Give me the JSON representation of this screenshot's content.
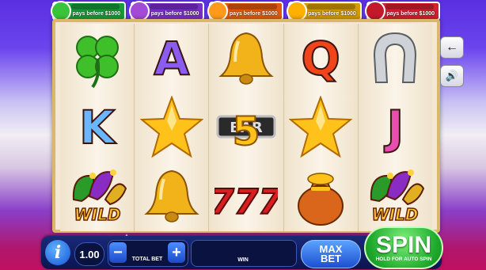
{
  "jackpots": [
    {
      "label": "pays before $1000",
      "color": "#1a9a3a",
      "face": "#3ac43a"
    },
    {
      "label": "pays before $1000",
      "color": "#7a2fc8",
      "face": "#a34ad6"
    },
    {
      "label": "pays before $1000",
      "color": "#e05a10",
      "face": "#ff9a1a"
    },
    {
      "label": "pays before $1000",
      "color": "#d49a00",
      "face": "#ffb000"
    },
    {
      "label": "pays before $1000",
      "color": "#d42030",
      "face": "#c21a2a"
    }
  ],
  "reels": [
    [
      "clover-icon",
      "K",
      "wild-jester-icon"
    ],
    [
      "A",
      "star-icon",
      "bell-icon"
    ],
    [
      "bell-icon",
      "bar-5-icon",
      "seven-icon"
    ],
    [
      "Q",
      "star-icon",
      "money-bag-icon"
    ],
    [
      "horseshoe-icon",
      "J",
      "wild-jester-icon"
    ]
  ],
  "symbols": {
    "wild": "WILD",
    "bar_text": "BAR",
    "bar_digit": "5",
    "seven": "777"
  },
  "side": {
    "back_icon": "←",
    "sound_icon": "🔊"
  },
  "bottom": {
    "info_icon": "i",
    "bet_value": "1.00",
    "minus": "−",
    "plus": "+",
    "total_bet_label": "TOTAL BET",
    "win_label": "WIN",
    "max_bet_line1": "MAX",
    "max_bet_line2": "BET",
    "spin_label": "SPIN",
    "spin_sub": "HOLD FOR AUTO SPIN",
    "triangle": "▲"
  }
}
